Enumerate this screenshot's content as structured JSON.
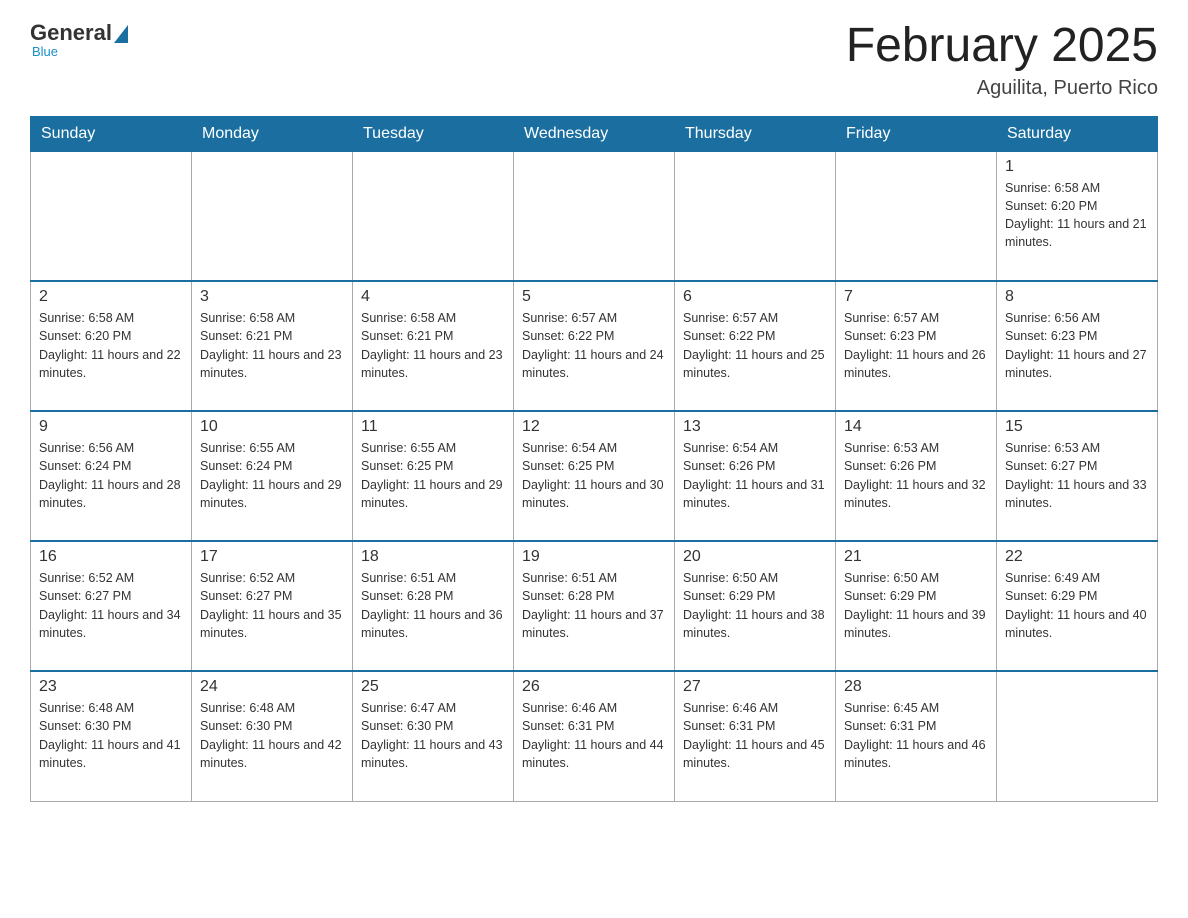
{
  "header": {
    "logo_general": "General",
    "logo_blue": "Blue",
    "logo_subtitle": "Blue",
    "month_title": "February 2025",
    "location": "Aguilita, Puerto Rico"
  },
  "days_of_week": [
    "Sunday",
    "Monday",
    "Tuesday",
    "Wednesday",
    "Thursday",
    "Friday",
    "Saturday"
  ],
  "weeks": [
    [
      {
        "day": "",
        "info": "",
        "empty": true
      },
      {
        "day": "",
        "info": "",
        "empty": true
      },
      {
        "day": "",
        "info": "",
        "empty": true
      },
      {
        "day": "",
        "info": "",
        "empty": true
      },
      {
        "day": "",
        "info": "",
        "empty": true
      },
      {
        "day": "",
        "info": "",
        "empty": true
      },
      {
        "day": "1",
        "info": "Sunrise: 6:58 AM\nSunset: 6:20 PM\nDaylight: 11 hours and 21 minutes."
      }
    ],
    [
      {
        "day": "2",
        "info": "Sunrise: 6:58 AM\nSunset: 6:20 PM\nDaylight: 11 hours and 22 minutes."
      },
      {
        "day": "3",
        "info": "Sunrise: 6:58 AM\nSunset: 6:21 PM\nDaylight: 11 hours and 23 minutes."
      },
      {
        "day": "4",
        "info": "Sunrise: 6:58 AM\nSunset: 6:21 PM\nDaylight: 11 hours and 23 minutes."
      },
      {
        "day": "5",
        "info": "Sunrise: 6:57 AM\nSunset: 6:22 PM\nDaylight: 11 hours and 24 minutes."
      },
      {
        "day": "6",
        "info": "Sunrise: 6:57 AM\nSunset: 6:22 PM\nDaylight: 11 hours and 25 minutes."
      },
      {
        "day": "7",
        "info": "Sunrise: 6:57 AM\nSunset: 6:23 PM\nDaylight: 11 hours and 26 minutes."
      },
      {
        "day": "8",
        "info": "Sunrise: 6:56 AM\nSunset: 6:23 PM\nDaylight: 11 hours and 27 minutes."
      }
    ],
    [
      {
        "day": "9",
        "info": "Sunrise: 6:56 AM\nSunset: 6:24 PM\nDaylight: 11 hours and 28 minutes."
      },
      {
        "day": "10",
        "info": "Sunrise: 6:55 AM\nSunset: 6:24 PM\nDaylight: 11 hours and 29 minutes."
      },
      {
        "day": "11",
        "info": "Sunrise: 6:55 AM\nSunset: 6:25 PM\nDaylight: 11 hours and 29 minutes."
      },
      {
        "day": "12",
        "info": "Sunrise: 6:54 AM\nSunset: 6:25 PM\nDaylight: 11 hours and 30 minutes."
      },
      {
        "day": "13",
        "info": "Sunrise: 6:54 AM\nSunset: 6:26 PM\nDaylight: 11 hours and 31 minutes."
      },
      {
        "day": "14",
        "info": "Sunrise: 6:53 AM\nSunset: 6:26 PM\nDaylight: 11 hours and 32 minutes."
      },
      {
        "day": "15",
        "info": "Sunrise: 6:53 AM\nSunset: 6:27 PM\nDaylight: 11 hours and 33 minutes."
      }
    ],
    [
      {
        "day": "16",
        "info": "Sunrise: 6:52 AM\nSunset: 6:27 PM\nDaylight: 11 hours and 34 minutes."
      },
      {
        "day": "17",
        "info": "Sunrise: 6:52 AM\nSunset: 6:27 PM\nDaylight: 11 hours and 35 minutes."
      },
      {
        "day": "18",
        "info": "Sunrise: 6:51 AM\nSunset: 6:28 PM\nDaylight: 11 hours and 36 minutes."
      },
      {
        "day": "19",
        "info": "Sunrise: 6:51 AM\nSunset: 6:28 PM\nDaylight: 11 hours and 37 minutes."
      },
      {
        "day": "20",
        "info": "Sunrise: 6:50 AM\nSunset: 6:29 PM\nDaylight: 11 hours and 38 minutes."
      },
      {
        "day": "21",
        "info": "Sunrise: 6:50 AM\nSunset: 6:29 PM\nDaylight: 11 hours and 39 minutes."
      },
      {
        "day": "22",
        "info": "Sunrise: 6:49 AM\nSunset: 6:29 PM\nDaylight: 11 hours and 40 minutes."
      }
    ],
    [
      {
        "day": "23",
        "info": "Sunrise: 6:48 AM\nSunset: 6:30 PM\nDaylight: 11 hours and 41 minutes."
      },
      {
        "day": "24",
        "info": "Sunrise: 6:48 AM\nSunset: 6:30 PM\nDaylight: 11 hours and 42 minutes."
      },
      {
        "day": "25",
        "info": "Sunrise: 6:47 AM\nSunset: 6:30 PM\nDaylight: 11 hours and 43 minutes."
      },
      {
        "day": "26",
        "info": "Sunrise: 6:46 AM\nSunset: 6:31 PM\nDaylight: 11 hours and 44 minutes."
      },
      {
        "day": "27",
        "info": "Sunrise: 6:46 AM\nSunset: 6:31 PM\nDaylight: 11 hours and 45 minutes."
      },
      {
        "day": "28",
        "info": "Sunrise: 6:45 AM\nSunset: 6:31 PM\nDaylight: 11 hours and 46 minutes."
      },
      {
        "day": "",
        "info": "",
        "empty": true
      }
    ]
  ]
}
